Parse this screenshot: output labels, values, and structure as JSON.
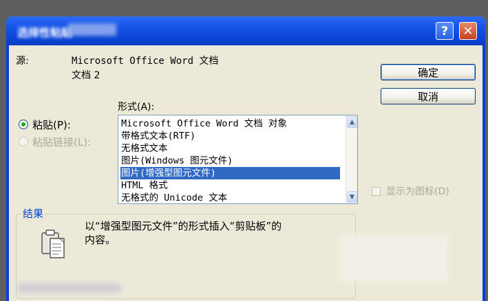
{
  "dialog": {
    "title": "选择性粘贴",
    "help_label": "?",
    "close_label": "✕"
  },
  "source": {
    "label": "源:",
    "line1": "Microsoft Office Word 文档",
    "line2": "文档 2"
  },
  "format_label": "形式(A):",
  "radios": {
    "paste": "粘贴(P):",
    "paste_link": "粘贴链接(L):"
  },
  "formats": [
    "Microsoft Office Word 文档 对象",
    "带格式文本(RTF)",
    "无格式文本",
    "图片(Windows 图元文件)",
    "图片(增强型图元文件)",
    "HTML 格式",
    "无格式的 Unicode 文本"
  ],
  "selected_format_index": 4,
  "buttons": {
    "ok": "确定",
    "cancel": "取消"
  },
  "display_as_icon": "显示为图标(D)",
  "result": {
    "title": "结果",
    "line1": "以“增强型图元文件”的形式插入“剪贴板”的",
    "line2": "内容。"
  },
  "colors": {
    "titlebar": "#0a3fd6",
    "selection": "#316ac5",
    "dialog_bg": "#ece9d8",
    "group_title": "#0046d5"
  }
}
